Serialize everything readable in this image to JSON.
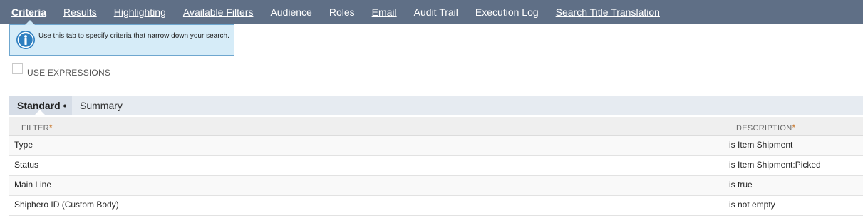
{
  "tabs": [
    {
      "label": "Criteria",
      "active": true
    },
    {
      "label": "Results",
      "active": false
    },
    {
      "label": "Highlighting",
      "active": false
    },
    {
      "label": "Available Filters",
      "active": false
    },
    {
      "label": "Audience",
      "active": false
    },
    {
      "label": "Roles",
      "active": false
    },
    {
      "label": "Email",
      "active": false
    },
    {
      "label": "Audit Trail",
      "active": false
    },
    {
      "label": "Execution Log",
      "active": false
    },
    {
      "label": "Search Title Translation",
      "active": false
    }
  ],
  "colors": {
    "tabbar_bg": "#5f6f86",
    "tip_bg": "#d6ecf8",
    "tip_border": "#6fa7cf",
    "info_icon": "#2e7fc0",
    "required_star": "#c8762a"
  },
  "info_tip": {
    "icon": "info-icon",
    "text": "Use this tab to specify criteria that narrow down your search."
  },
  "use_expressions": {
    "label": "USE EXPRESSIONS",
    "checked": false
  },
  "subtabs": {
    "standard": "Standard",
    "standard_marker": "•",
    "summary": "Summary",
    "active": "Standard"
  },
  "criteria_table": {
    "headers": {
      "filter": "FILTER",
      "description": "DESCRIPTION",
      "required_marker": "*"
    },
    "rows": [
      {
        "filter": "Type",
        "description": "is Item Shipment"
      },
      {
        "filter": "Status",
        "description": "is Item Shipment:Picked"
      },
      {
        "filter": "Main Line",
        "description": "is true"
      },
      {
        "filter": "Shiphero ID (Custom Body)",
        "description": "is not empty"
      }
    ]
  }
}
